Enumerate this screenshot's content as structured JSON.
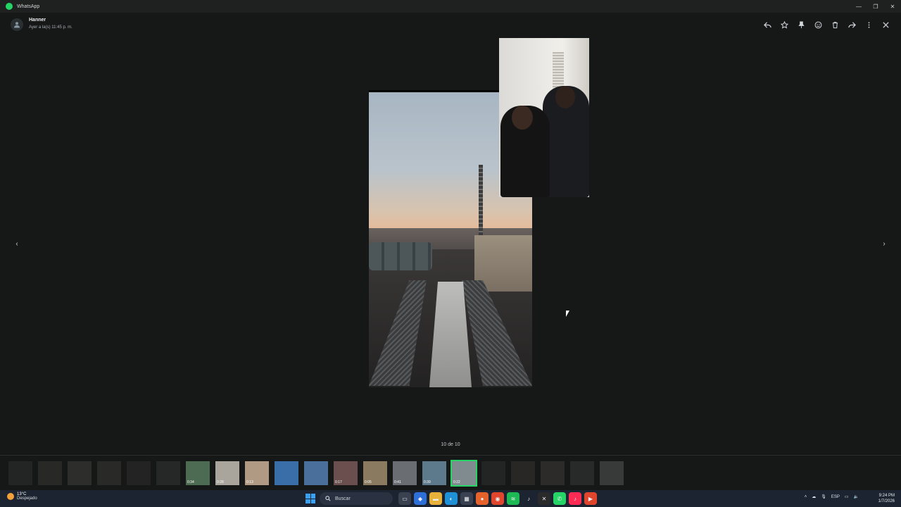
{
  "window": {
    "title": "WhatsApp"
  },
  "header": {
    "sender": "Hanner",
    "sent_time": "Ayer a la(s) 11:45 p. m."
  },
  "toolbar": {
    "icons": [
      "reply-icon",
      "star-icon",
      "pin-icon",
      "emoji-icon",
      "delete-icon",
      "forward-icon",
      "more-icon",
      "close-icon"
    ]
  },
  "viewer": {
    "counter": "10 de 10"
  },
  "thumbnails": [
    {
      "duration": "",
      "dim": true,
      "color": "#3c3c3c"
    },
    {
      "duration": "",
      "dim": true,
      "color": "#4a4a44"
    },
    {
      "duration": "",
      "dim": true,
      "color": "#5a5650"
    },
    {
      "duration": "",
      "dim": true,
      "color": "#4e4a46"
    },
    {
      "duration": "",
      "dim": true,
      "color": "#3f3a38"
    },
    {
      "duration": "",
      "dim": true,
      "color": "#444"
    },
    {
      "duration": "0:34",
      "dim": false,
      "color": "#4d6a52"
    },
    {
      "duration": "0:28",
      "dim": false,
      "color": "#a9a49c"
    },
    {
      "duration": "0:13",
      "dim": false,
      "color": "#b09a84"
    },
    {
      "duration": "",
      "dim": false,
      "color": "#3a6ea8"
    },
    {
      "duration": "",
      "dim": false,
      "color": "#4a6f9a"
    },
    {
      "duration": "0:17",
      "dim": false,
      "color": "#6b4e4e"
    },
    {
      "duration": "0:05",
      "dim": false,
      "color": "#8a7a60"
    },
    {
      "duration": "0:41",
      "dim": false,
      "color": "#6a6e72"
    },
    {
      "duration": "0:39",
      "dim": false,
      "color": "#5d7a8c"
    },
    {
      "duration": "0:22",
      "dim": false,
      "active": true,
      "color": "#7f8b8f"
    },
    {
      "duration": "",
      "dim": true,
      "color": "#3d3d3d"
    },
    {
      "duration": "",
      "dim": true,
      "color": "#4a4540"
    },
    {
      "duration": "",
      "dim": true,
      "color": "#55504a"
    },
    {
      "duration": "",
      "dim": true,
      "color": "#4a4a4a"
    },
    {
      "duration": "",
      "dim": true,
      "color": "#777"
    }
  ],
  "taskbar": {
    "weather": {
      "temp": "13°C",
      "condition": "Despejado"
    },
    "search_label": "Buscar",
    "apps": [
      {
        "icon": "task-view-icon",
        "color": "#3a4252",
        "glyph": "▭"
      },
      {
        "icon": "copilot-icon",
        "color": "#2f6fd8",
        "glyph": "◆"
      },
      {
        "icon": "file-explorer-icon",
        "color": "#e8b23a",
        "glyph": "▬"
      },
      {
        "icon": "edge-icon",
        "color": "#1f8fd6",
        "glyph": "◐"
      },
      {
        "icon": "store-icon",
        "color": "#3a4252",
        "glyph": "▦"
      },
      {
        "icon": "firefox-icon",
        "color": "#e5622c",
        "glyph": "●"
      },
      {
        "icon": "chrome-icon",
        "color": "#e0452e",
        "glyph": "◉"
      },
      {
        "icon": "spotify-icon",
        "color": "#1db954",
        "glyph": "≋"
      },
      {
        "icon": "tiktok-icon",
        "color": "#1c2431",
        "glyph": "♪"
      },
      {
        "icon": "capcut-icon",
        "color": "#2a2a2a",
        "glyph": "✕"
      },
      {
        "icon": "whatsapp-icon",
        "color": "#25d366",
        "glyph": "✆"
      },
      {
        "icon": "tiktok-studio-icon",
        "color": "#fe2c55",
        "glyph": "♪"
      },
      {
        "icon": "media-player-icon",
        "color": "#e0452e",
        "glyph": "▶"
      }
    ],
    "tray": {
      "language": "ESP"
    },
    "clock": {
      "time": "9:24 PM",
      "date": "1/7/2026"
    }
  }
}
